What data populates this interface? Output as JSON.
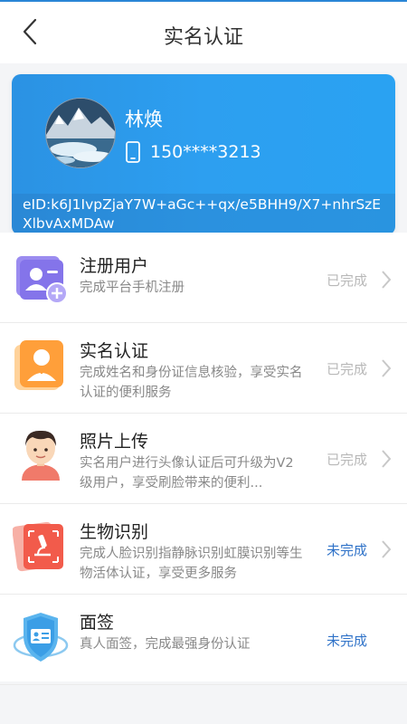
{
  "header": {
    "title": "实名认证"
  },
  "profile": {
    "name": "林焕",
    "phone": "150****3213",
    "eid": "eID:k6J1IvpZjaY7W+aGc++qx/e5BHH9/X7+nhrSzEXlbvAxMDAw"
  },
  "items": [
    {
      "title": "注册用户",
      "desc": "完成平台手机注册",
      "status": "已完成",
      "icon": "register-user-icon"
    },
    {
      "title": "实名认证",
      "desc": "完成姓名和身份证信息核验，享受实名认证的便利服务",
      "status": "已完成",
      "icon": "real-name-icon"
    },
    {
      "title": "照片上传",
      "desc": "实名用户进行头像认证后可升级为V2级用户，享受刷脸带来的便利...",
      "status": "已完成",
      "icon": "photo-upload-icon"
    },
    {
      "title": "生物识别",
      "desc": "完成人脸识别指静脉识别虹膜识别等生物活体认证，享受更多服务",
      "status": "未完成",
      "icon": "biometric-icon"
    },
    {
      "title": "面签",
      "desc": "真人面签，完成最强身份认证",
      "status": "未完成",
      "icon": "face-sign-icon"
    }
  ],
  "colors": {
    "accent": "#2b95e8",
    "done": "#b8b8b8",
    "todo": "#2f72c8"
  }
}
